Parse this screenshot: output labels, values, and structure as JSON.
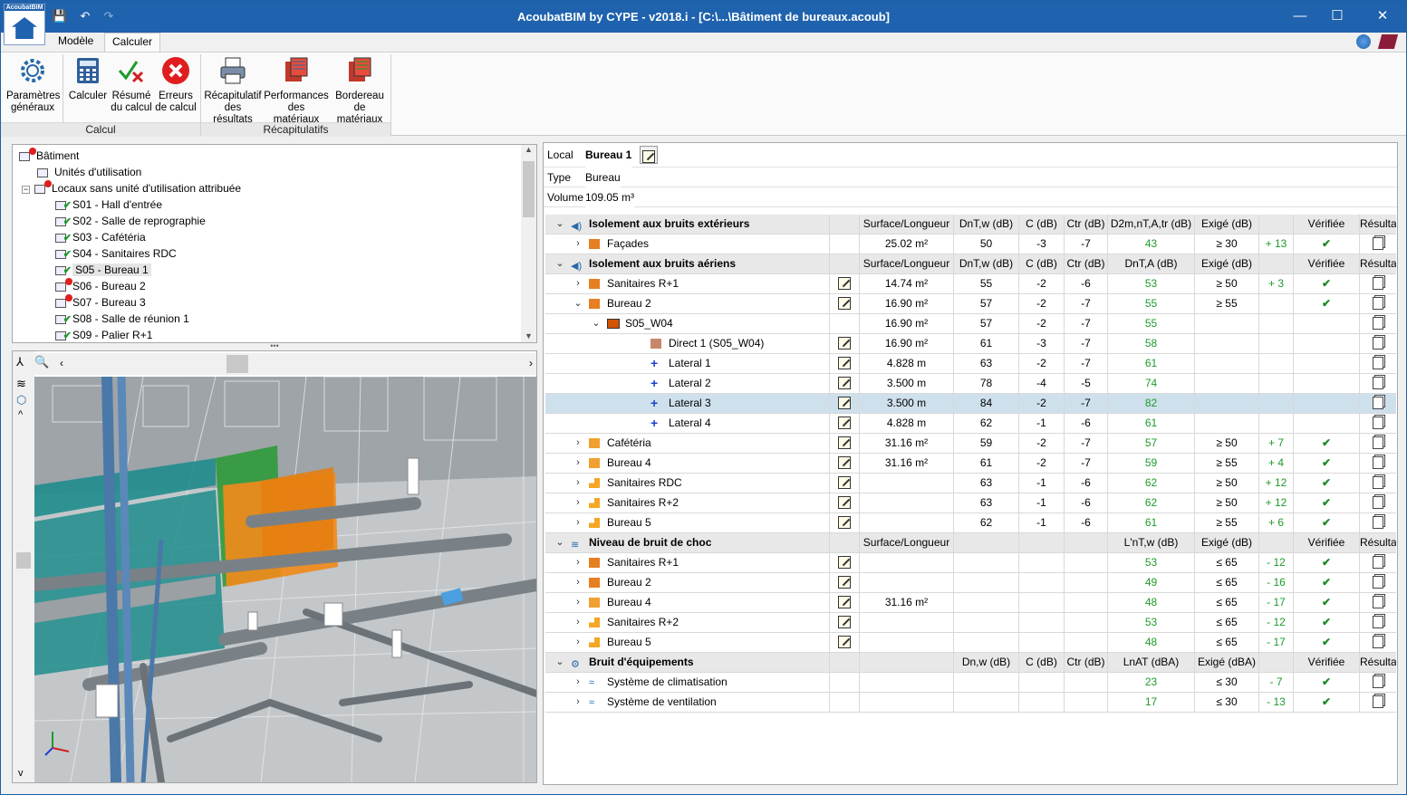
{
  "window": {
    "title": "AcoubatBIM by CYPE - v2018.i - [C:\\...\\Bâtiment de bureaux.acoub]",
    "app_logo_text": "AcoubatBIM"
  },
  "tabs": [
    "Modèle",
    "Calculer"
  ],
  "ribbon": {
    "buttons": [
      {
        "line1": "Paramètres",
        "line2": "généraux"
      },
      {
        "line1": "Calculer",
        "line2": ""
      },
      {
        "line1": "Résumé",
        "line2": "du calcul"
      },
      {
        "line1": "Erreurs",
        "line2": "de calcul"
      },
      {
        "line1": "Récapitulatif",
        "line2": "des résultats"
      },
      {
        "line1": "Performances",
        "line2": "des matériaux"
      },
      {
        "line1": "Bordereau",
        "line2": "de matériaux"
      }
    ],
    "groups": [
      "Calcul",
      "Récapitulatifs"
    ]
  },
  "tree": {
    "nodes": [
      {
        "label": "Bâtiment"
      },
      {
        "label": "Unités d'utilisation"
      },
      {
        "label": "Locaux sans unité d'utilisation attribuée"
      },
      {
        "label": "S01 - Hall d'entrée"
      },
      {
        "label": "S02 - Salle de reprographie"
      },
      {
        "label": "S03 - Cafétéria"
      },
      {
        "label": "S04 - Sanitaires RDC"
      },
      {
        "label": "S05 - Bureau 1"
      },
      {
        "label": "S06 - Bureau 2"
      },
      {
        "label": "S07 - Bureau 3"
      },
      {
        "label": "S08 - Salle de réunion 1"
      },
      {
        "label": "S09 - Palier R+1"
      }
    ]
  },
  "info": {
    "local_label": "Local",
    "local_value": "Bureau 1",
    "type_label": "Type",
    "type_value": "Bureau",
    "volume_label": "Volume",
    "volume_value": "109.05  m³"
  },
  "sections": {
    "ext": {
      "title": "Isolement aux bruits extérieurs",
      "h": [
        "Surface/Longueur",
        "DnT,w (dB)",
        "C (dB)",
        "Ctr (dB)",
        "D2m,nT,A,tr (dB)",
        "Exigé (dB)",
        "",
        "Vérifiée",
        "Résultats"
      ]
    },
    "air": {
      "title": "Isolement aux bruits aériens",
      "h": [
        "Surface/Longueur",
        "DnT,w (dB)",
        "C (dB)",
        "Ctr (dB)",
        "DnT,A (dB)",
        "Exigé (dB)",
        "",
        "Vérifiée",
        "Résultats"
      ]
    },
    "choc": {
      "title": "Niveau de bruit de choc",
      "h": [
        "Surface/Longueur",
        "",
        "",
        "",
        "L'nT,w (dB)",
        "Exigé (dB)",
        "",
        "Vérifiée",
        "Résultats"
      ]
    },
    "equip": {
      "title": "Bruit d'équipements",
      "h": [
        "",
        "Dn,w (dB)",
        "C (dB)",
        "Ctr (dB)",
        "LnAT (dBA)",
        "Exigé (dBA)",
        "",
        "Vérifiée",
        "Résultats"
      ]
    }
  },
  "rows": [
    {
      "name": "Façades",
      "v": [
        "25.02 m²",
        "50",
        "-3",
        "-7",
        "43",
        "≥ 30",
        "+ 13",
        "✔"
      ]
    },
    {
      "name": "Sanitaires R+1",
      "v": [
        "14.74 m²",
        "55",
        "-2",
        "-6",
        "53",
        "≥ 50",
        "+ 3",
        "✔"
      ]
    },
    {
      "name": "Bureau 2",
      "v": [
        "16.90 m²",
        "57",
        "-2",
        "-7",
        "55",
        "≥ 55",
        "",
        "✔"
      ]
    },
    {
      "name": "S05_W04",
      "v": [
        "16.90 m²",
        "57",
        "-2",
        "-7",
        "55",
        "",
        "",
        ""
      ]
    },
    {
      "name": "Direct 1 (S05_W04)",
      "v": [
        "16.90 m²",
        "61",
        "-3",
        "-7",
        "58",
        "",
        "",
        ""
      ]
    },
    {
      "name": "Lateral 1",
      "v": [
        "4.828 m",
        "63",
        "-2",
        "-7",
        "61",
        "",
        "",
        ""
      ]
    },
    {
      "name": "Lateral 2",
      "v": [
        "3.500 m",
        "78",
        "-4",
        "-5",
        "74",
        "",
        "",
        ""
      ]
    },
    {
      "name": "Lateral 3",
      "v": [
        "3.500 m",
        "84",
        "-2",
        "-7",
        "82",
        "",
        "",
        ""
      ]
    },
    {
      "name": "Lateral 4",
      "v": [
        "4.828 m",
        "62",
        "-1",
        "-6",
        "61",
        "",
        "",
        ""
      ]
    },
    {
      "name": "Cafétéria",
      "v": [
        "31.16 m²",
        "59",
        "-2",
        "-7",
        "57",
        "≥ 50",
        "+ 7",
        "✔"
      ]
    },
    {
      "name": "Bureau 4",
      "v": [
        "31.16 m²",
        "61",
        "-2",
        "-7",
        "59",
        "≥ 55",
        "+ 4",
        "✔"
      ]
    },
    {
      "name": "Sanitaires RDC",
      "v": [
        "",
        "63",
        "-1",
        "-6",
        "62",
        "≥ 50",
        "+ 12",
        "✔"
      ]
    },
    {
      "name": "Sanitaires R+2",
      "v": [
        "",
        "63",
        "-1",
        "-6",
        "62",
        "≥ 50",
        "+ 12",
        "✔"
      ]
    },
    {
      "name": "Bureau 5",
      "v": [
        "",
        "62",
        "-1",
        "-6",
        "61",
        "≥ 55",
        "+ 6",
        "✔"
      ]
    },
    {
      "name": "Sanitaires R+1",
      "v": [
        "",
        "",
        "",
        "",
        "53",
        "≤ 65",
        "- 12",
        "✔"
      ]
    },
    {
      "name": "Bureau 2",
      "v": [
        "",
        "",
        "",
        "",
        "49",
        "≤ 65",
        "- 16",
        "✔"
      ]
    },
    {
      "name": "Bureau 4",
      "v": [
        "31.16 m²",
        "",
        "",
        "",
        "48",
        "≤ 65",
        "- 17",
        "✔"
      ]
    },
    {
      "name": "Sanitaires R+2",
      "v": [
        "",
        "",
        "",
        "",
        "53",
        "≤ 65",
        "- 12",
        "✔"
      ]
    },
    {
      "name": "Bureau 5",
      "v": [
        "",
        "",
        "",
        "",
        "48",
        "≤ 65",
        "- 17",
        "✔"
      ]
    },
    {
      "name": "Système de climatisation",
      "v": [
        "",
        "",
        "",
        "",
        "23",
        "≤ 30",
        "- 7",
        "✔"
      ]
    },
    {
      "name": "Système de ventilation",
      "v": [
        "",
        "",
        "",
        "",
        "17",
        "≤ 30",
        "- 13",
        "✔"
      ]
    }
  ],
  "colors": {
    "titlebar": "#1f62ad",
    "green": "#1e9a2a",
    "selected_row": "#cfe0ed",
    "orange": "#f08a1c",
    "teal": "#1f8c8c"
  }
}
